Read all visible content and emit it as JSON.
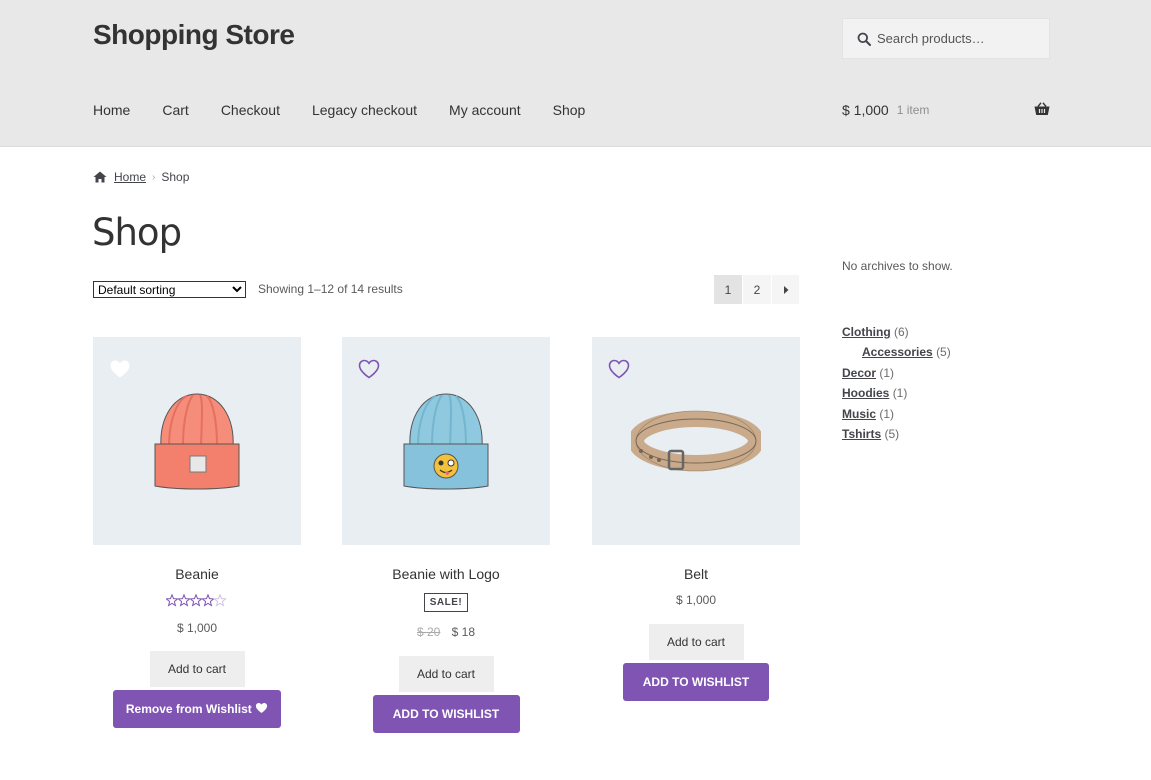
{
  "header": {
    "site_title": "Shopping Store",
    "search_placeholder": "Search products…",
    "nav": [
      "Home",
      "Cart",
      "Checkout",
      "Legacy checkout",
      "My account",
      "Shop"
    ],
    "cart_amount": "$ 1,000",
    "cart_count": "1 item"
  },
  "breadcrumb": {
    "home": "Home",
    "current": "Shop"
  },
  "page_title": "Shop",
  "toolbar": {
    "sorting_selected": "Default sorting",
    "result_count": "Showing 1–12 of 14 results",
    "pages": [
      "1",
      "2"
    ],
    "current_page": "1"
  },
  "products": [
    {
      "title": "Beanie",
      "rating": 3.5,
      "price": "$ 1,000",
      "add_to_cart": "Add to cart",
      "wishlist_label": "Remove from Wishlist",
      "wishlisted": true
    },
    {
      "title": "Beanie with Logo",
      "sale_badge": "SALE!",
      "old_price": "$ 20",
      "price": "$ 18",
      "add_to_cart": "Add to cart",
      "wishlist_label": "ADD TO WISHLIST",
      "wishlisted": false
    },
    {
      "title": "Belt",
      "price": "$ 1,000",
      "add_to_cart": "Add to cart",
      "wishlist_label": "ADD TO WISHLIST",
      "wishlisted": false
    }
  ],
  "sidebar": {
    "no_archives": "No archives to show.",
    "categories": [
      {
        "name": "Clothing",
        "count": "(6)"
      },
      {
        "name": "Accessories",
        "count": "(5)",
        "child": true
      },
      {
        "name": "Decor",
        "count": "(1)"
      },
      {
        "name": "Hoodies",
        "count": "(1)"
      },
      {
        "name": "Music",
        "count": "(1)"
      },
      {
        "name": "Tshirts",
        "count": "(5)"
      }
    ]
  },
  "colors": {
    "header_bg": "#e8e8e8",
    "accent_purple": "#7f54b3",
    "product_bg": "#e8eef2"
  },
  "icons": [
    "search-icon",
    "basket-icon",
    "home-icon",
    "heart-icon",
    "star-icon",
    "chevron-right-icon"
  ]
}
